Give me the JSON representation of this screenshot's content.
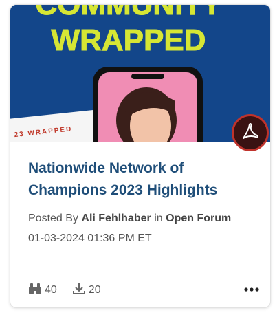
{
  "card": {
    "thumbnail": {
      "headline_line1": "COMMUNITY",
      "headline_line2": "WRAPPED",
      "tag_text": "23 WRAPPED",
      "bg_color": "#13468a",
      "headline_color": "#d6e634",
      "phone_screen_color": "#f08db4"
    },
    "file_type_icon": "pdf-icon",
    "title": "Nationwide Network of Champions 2023 Highlights",
    "posted_by_label": "Posted By",
    "author": "Ali Fehlhaber",
    "in_label": "in",
    "community": "Open Forum",
    "date": "01-03-2024 01:36 PM ET",
    "stats": {
      "views_icon": "binoculars-icon",
      "views": "40",
      "downloads_icon": "download-icon",
      "downloads": "20"
    },
    "more_icon": "more-options-icon",
    "title_color": "#1f4e79"
  }
}
